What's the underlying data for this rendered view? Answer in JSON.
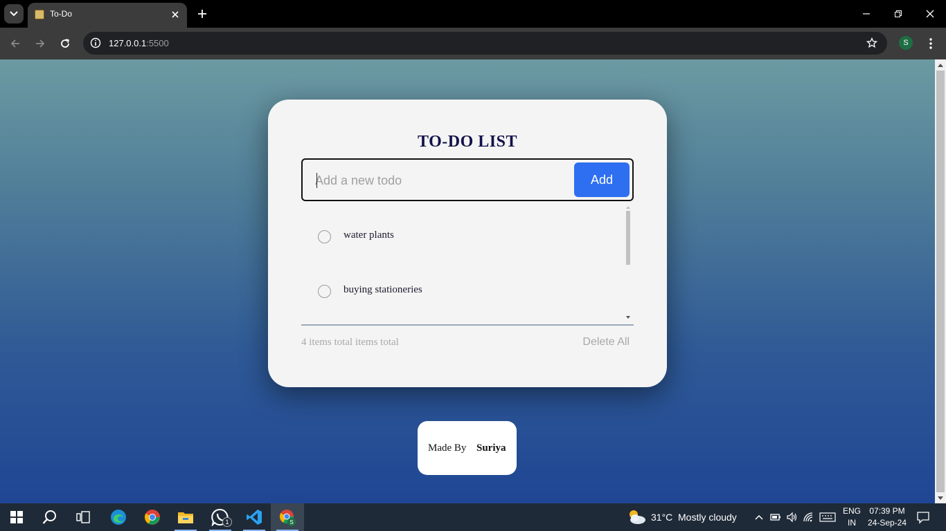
{
  "browser": {
    "tab_title": "To-Do",
    "url_host": "127.0.0.1",
    "url_port": ":5500",
    "profile_initial": "S"
  },
  "app": {
    "title": "TO-DO LIST",
    "input_placeholder": "Add a new todo",
    "input_value": "",
    "add_label": "Add",
    "todos": [
      {
        "text": "water plants",
        "done": false
      },
      {
        "text": "buying stationeries",
        "done": false
      }
    ],
    "count_text": "4 items total items total",
    "delete_all_label": "Delete All"
  },
  "credit": {
    "made_by_label": "Made By",
    "author": "Suriya"
  },
  "taskbar": {
    "apps": [
      "start-icon",
      "search-icon",
      "task-view-icon",
      "edge-icon",
      "chrome-icon",
      "file-explorer-icon",
      "whatsapp-icon",
      "vscode-icon",
      "chrome-profile-icon"
    ],
    "whatsapp_badge": "1",
    "weather_temp": "31°C",
    "weather_desc": "Mostly cloudy",
    "lang_top": "ENG",
    "lang_bottom": "IN",
    "time": "07:39 PM",
    "date": "24-Sep-24"
  },
  "colors": {
    "accent": "#2d6ff0",
    "title": "#12124a",
    "card": "#f4f4f4"
  }
}
